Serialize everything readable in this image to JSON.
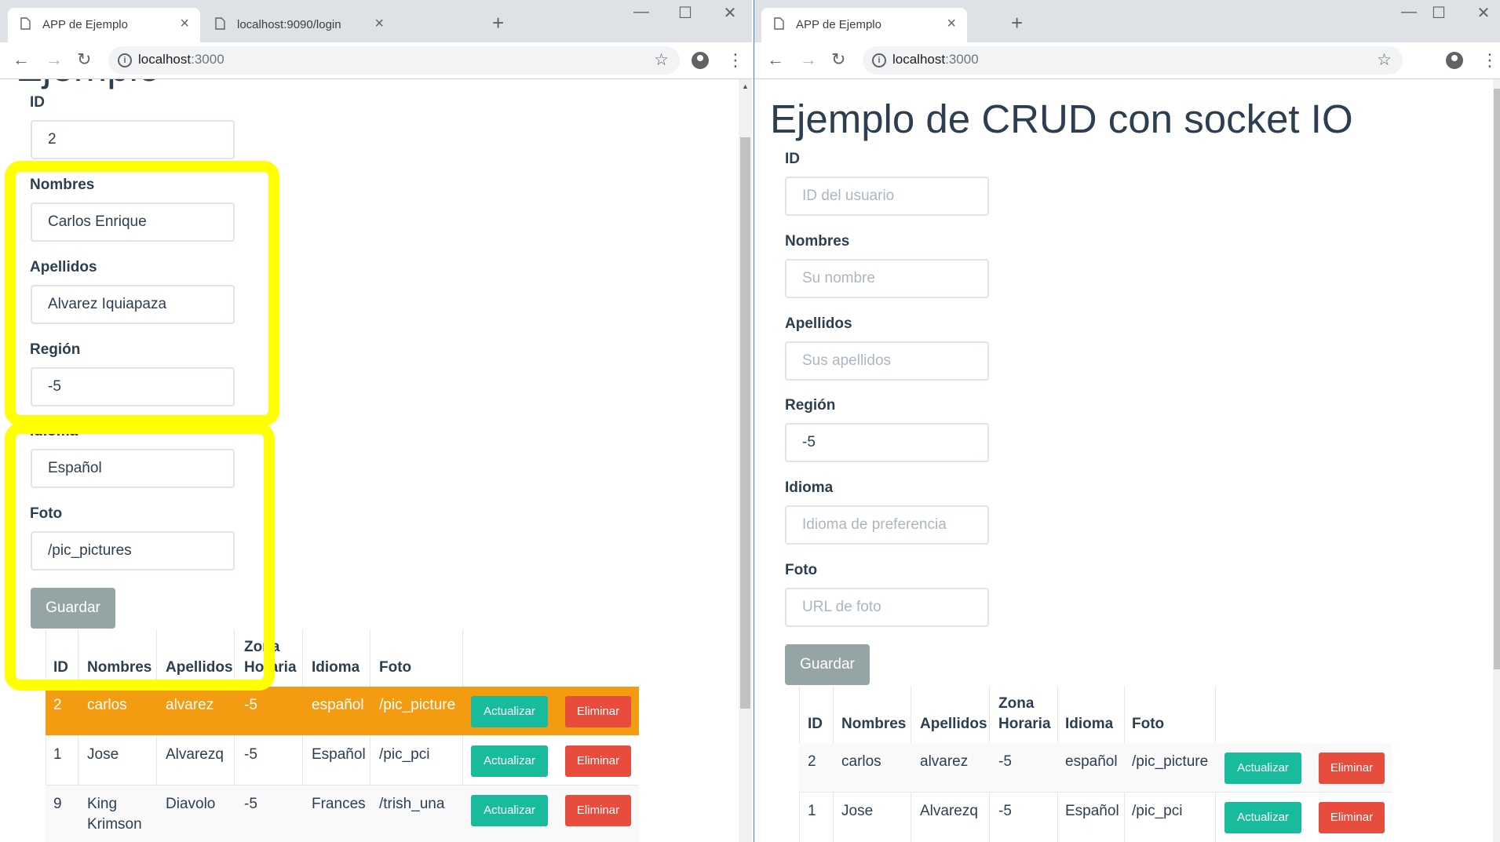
{
  "left": {
    "tabs": [
      {
        "title": "APP de Ejemplo",
        "close": "×"
      },
      {
        "title": "localhost:9090/login",
        "close": "×"
      }
    ],
    "new_tab": "+",
    "window_controls": {
      "minimize": "—",
      "maximize": "☐",
      "close": "✕"
    },
    "url_host": "localhost",
    "url_port": ":3000",
    "partial_title": "Ejemplo",
    "form": {
      "id_label": "ID",
      "id_value": "2",
      "nombres_label": "Nombres",
      "nombres_value": "Carlos Enrique",
      "apellidos_label": "Apellidos",
      "apellidos_value": "Alvarez Iquiapaza",
      "region_label": "Región",
      "region_value": "-5",
      "idioma_label": "Idioma",
      "idioma_value": "Español",
      "foto_label": "Foto",
      "foto_value": "/pic_pictures",
      "save_label": "Guardar"
    },
    "table": {
      "headers": [
        "ID",
        "Nombres",
        "Apellidos",
        "Zona",
        "Horaria",
        "Idioma",
        "Foto"
      ],
      "rows": [
        {
          "id": "2",
          "nombres": "carlos",
          "apellidos": "alvarez",
          "zona": "-5",
          "idioma": "español",
          "foto": "/pic_picture",
          "nombres2": ""
        },
        {
          "id": "1",
          "nombres": "Jose",
          "apellidos": "Alvarezq",
          "zona": "-5",
          "idioma": "Español",
          "foto": "/pic_pci",
          "nombres2": ""
        },
        {
          "id": "9",
          "nombres": "King",
          "apellidos": "Diavolo",
          "zona": "-5",
          "idioma": "Frances",
          "foto": "/trish_una",
          "nombres2": "Krimson"
        }
      ],
      "update_label": "Actualizar",
      "delete_label": "Eliminar",
      "highlight_color": "#f39c12"
    },
    "annotation_color": "#ffff00"
  },
  "right": {
    "tabs": [
      {
        "title": "APP de Ejemplo",
        "close": "×"
      }
    ],
    "new_tab": "+",
    "window_controls": {
      "minimize": "—",
      "maximize": "☐",
      "close": "✕"
    },
    "url_host": "localhost",
    "url_port": ":3000",
    "title": "Ejemplo de CRUD con socket IO",
    "form": {
      "id_label": "ID",
      "id_placeholder": "ID del usuario",
      "nombres_label": "Nombres",
      "nombres_placeholder": "Su nombre",
      "apellidos_label": "Apellidos",
      "apellidos_placeholder": "Sus apellidos",
      "region_label": "Región",
      "region_value": "-5",
      "idioma_label": "Idioma",
      "idioma_placeholder": "Idioma de preferencia",
      "foto_label": "Foto",
      "foto_placeholder": "URL de foto",
      "save_label": "Guardar"
    },
    "table": {
      "headers": [
        "ID",
        "Nombres",
        "Apellidos",
        "Zona",
        "Horaria",
        "Idioma",
        "Foto"
      ],
      "rows": [
        {
          "id": "2",
          "nombres": "carlos",
          "apellidos": "alvarez",
          "zona": "-5",
          "idioma": "español",
          "foto": "/pic_picture"
        },
        {
          "id": "1",
          "nombres": "Jose",
          "apellidos": "Alvarezq",
          "zona": "-5",
          "idioma": "Español",
          "foto": "/pic_pci"
        }
      ],
      "update_label": "Actualizar",
      "delete_label": "Eliminar"
    }
  },
  "icons": {
    "back": "arrow-left-icon",
    "forward": "arrow-right-icon",
    "reload": "reload-icon",
    "star": "star-icon",
    "account": "account-icon",
    "menu": "kebab-menu-icon"
  },
  "colors": {
    "accent_success": "#18bc9c",
    "accent_danger": "#e74c3c",
    "save_button": "#95a5a6",
    "text": "#2c3e50"
  }
}
